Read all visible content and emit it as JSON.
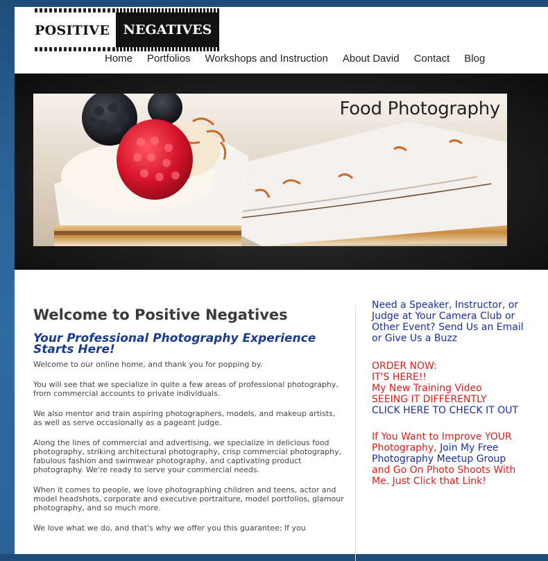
{
  "logo": {
    "left_text": "POSITIVE",
    "right_text": "NEGATIVES"
  },
  "nav": [
    "Home",
    "Portfolios",
    "Workshops and Instruction",
    "About David",
    "Contact",
    "Blog"
  ],
  "banner": {
    "title": "Food Photography"
  },
  "main": {
    "heading": "Welcome to Positive Negatives",
    "subheading": "Your Professional Photography Experience Starts Here!",
    "paragraphs": [
      "Welcome to our online home, and thank you for popping by.",
      "You will see that we specialize in quite a few areas of professional photography, from commercial accounts to private individuals.",
      "We also mentor and train aspiring photographers, models, and makeup artists, as well as serve occasionally as a pageant judge.",
      "Along the lines of commercial and advertising, we specialize in delicious food photography, striking architectural photography, crisp commercial photography, fabulous fashion and swimwear photography, and captivating product photography. We're ready to serve your commercial needs.",
      "When it comes to people, we love photographing children and teens, actor and model headshots, corporate and executive portraiture, model portfolios, glamour photography, and so much more.",
      "We love what we do, and that's why we offer you this guarantee: If you"
    ]
  },
  "sidebar": {
    "speaker": "Need a Speaker, Instructor, or Judge at Your Camera Club or Other Event? Send Us an Email or Give Us a Buzz",
    "order_now": "ORDER NOW:",
    "its_here": "IT'S HERE!!",
    "video_line": "My New Training Video",
    "video_title": "SEEING IT DIFFERENTLY",
    "click_here": "CLICK HERE TO CHECK IT OUT",
    "improve_red1": "If You Want to Improve YOUR Photography,",
    "improve_blue1": "Join My Free Photography Meetup Group",
    "improve_red2": "and Go On Photo Shoots With Me.",
    "improve_blue2": "Just Click that Link!"
  },
  "colors": {
    "background": "#2a6396",
    "link_blue": "#1a2f9a",
    "alert_red": "#e01b1b",
    "subheading": "#1a3a8c"
  }
}
